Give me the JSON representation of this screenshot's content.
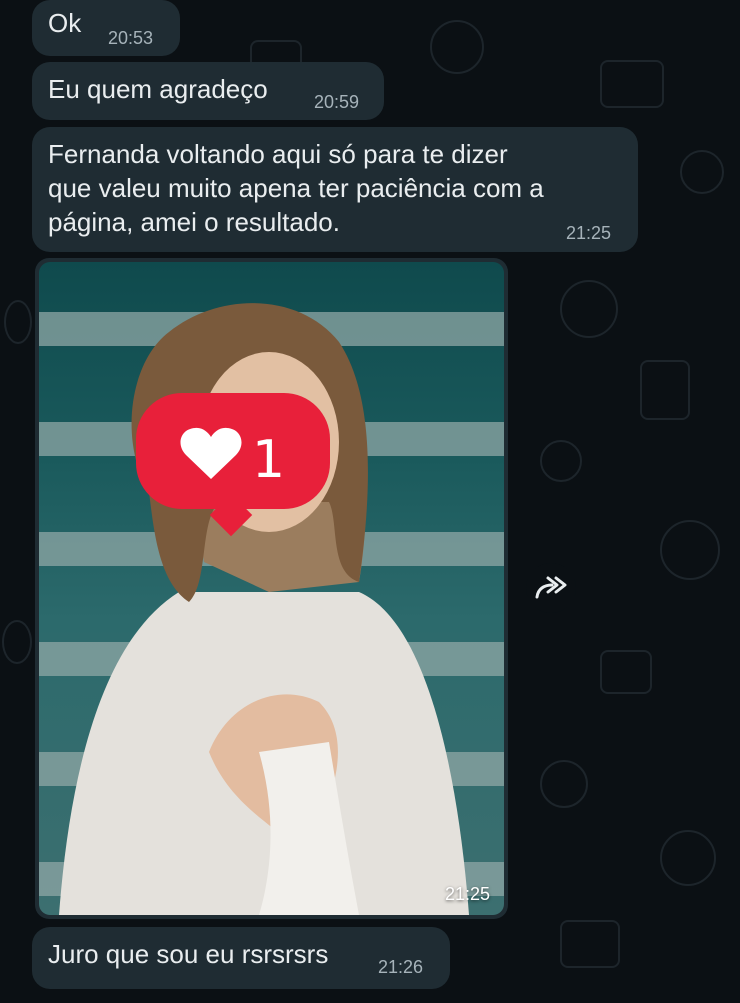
{
  "messages": [
    {
      "text": "Ok",
      "time": "20:53"
    },
    {
      "text": "Eu quem agradeço",
      "time": "20:59"
    },
    {
      "text": "Fernanda voltando aqui só para te dizer\nque valeu muito apena ter paciência com a\npágina, amei o resultado.",
      "time": "21:25"
    }
  ],
  "image_message": {
    "time": "21:25",
    "like_count": "1",
    "description_icon": "heart-icon"
  },
  "last_message": {
    "text": "Juro que sou eu rsrsrsrs",
    "time": "21:26"
  },
  "forward_icon": "forward-icon",
  "colors": {
    "background": "#0b1014",
    "bubble": "#1f2c33",
    "text": "#e9edef",
    "timestamp": "#a6b3ba",
    "like_badge": "#e8203a"
  }
}
